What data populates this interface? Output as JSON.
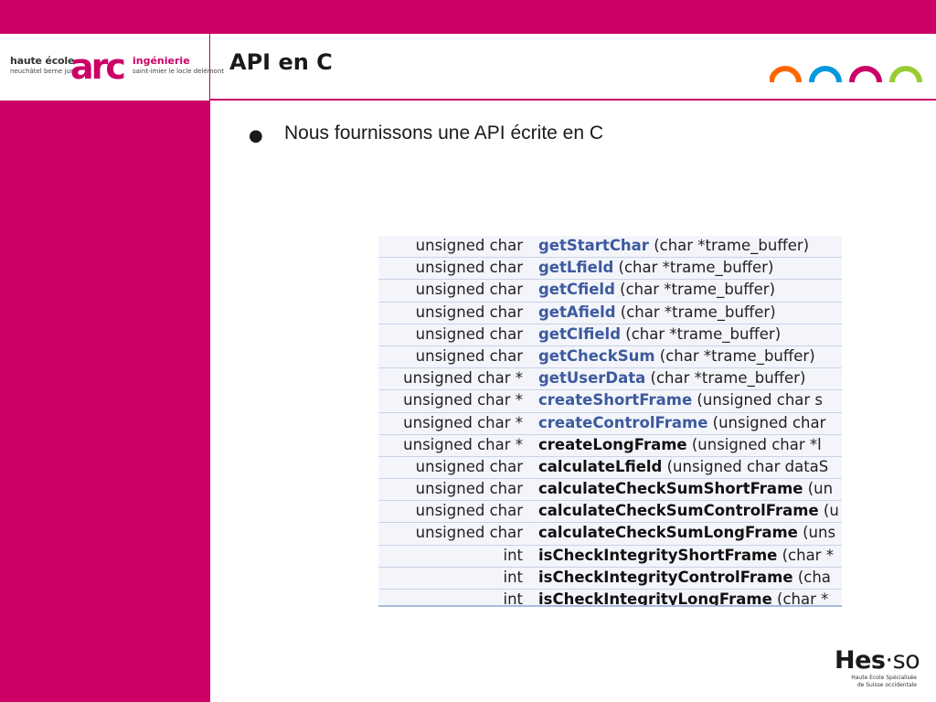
{
  "header": {
    "logo": {
      "school_line1": "haute école",
      "school_line2": "neuchâtel berne jura",
      "brand": "arc",
      "field_line1": "ingénierie",
      "field_line2": "saint-imier le locle delémont"
    },
    "title": "API en C"
  },
  "bullets": [
    {
      "marker": "●",
      "text": "Nous fournissons une API écrite en C"
    }
  ],
  "api_table": {
    "rows": [
      {
        "type": "unsigned char",
        "name": "getStartChar",
        "args": " (char *trame_buffer)",
        "linked": true
      },
      {
        "type": "unsigned char",
        "name": "getLfield",
        "args": " (char *trame_buffer)",
        "linked": true
      },
      {
        "type": "unsigned char",
        "name": "getCfield",
        "args": " (char *trame_buffer)",
        "linked": true
      },
      {
        "type": "unsigned char",
        "name": "getAfield",
        "args": " (char *trame_buffer)",
        "linked": true
      },
      {
        "type": "unsigned char",
        "name": "getCIfield",
        "args": " (char *trame_buffer)",
        "linked": true
      },
      {
        "type": "unsigned char",
        "name": "getCheckSum",
        "args": " (char *trame_buffer)",
        "linked": true
      },
      {
        "type": "unsigned char *",
        "name": "getUserData",
        "args": " (char *trame_buffer)",
        "linked": true
      },
      {
        "type": "unsigned char *",
        "name": "createShortFrame",
        "args": " (unsigned char s",
        "linked": true
      },
      {
        "type": "unsigned char *",
        "name": "createControlFrame",
        "args": " (unsigned char",
        "linked": true
      },
      {
        "type": "unsigned char *",
        "name": "createLongFrame",
        "args": " (unsigned char *l",
        "linked": false
      },
      {
        "type": "unsigned char",
        "name": "calculateLfield",
        "args": " (unsigned char dataS",
        "linked": false
      },
      {
        "type": "unsigned char",
        "name": "calculateCheckSumShortFrame",
        "args": " (un",
        "linked": false
      },
      {
        "type": "unsigned char",
        "name": "calculateCheckSumControlFrame",
        "args": " (u",
        "linked": false
      },
      {
        "type": "unsigned char",
        "name": "calculateCheckSumLongFrame",
        "args": " (uns",
        "linked": false
      },
      {
        "type": "int",
        "name": "isCheckIntegrityShortFrame",
        "args": " (char *",
        "linked": false
      },
      {
        "type": "int",
        "name": "isCheckIntegrityControlFrame",
        "args": " (cha",
        "linked": false
      },
      {
        "type": "int",
        "name": "isCheckIntegrityLongFrame",
        "args": " (char *",
        "linked": false
      }
    ]
  },
  "footer": {
    "hesso_main": "Hes",
    "hesso_dot": "·",
    "hesso_so": "so",
    "hesso_line1": "Haute Ecole Spécialisée",
    "hesso_line2": "de Suisse occidentale"
  },
  "colors": {
    "brand_magenta": "#cc0066",
    "arch_orange": "#ff6600",
    "arch_blue": "#0099dd",
    "arch_magenta": "#cc0066",
    "arch_green": "#99cc33",
    "link_blue": "#3d5a9e"
  },
  "icons": {
    "arches": "decorative-arches-icon"
  }
}
